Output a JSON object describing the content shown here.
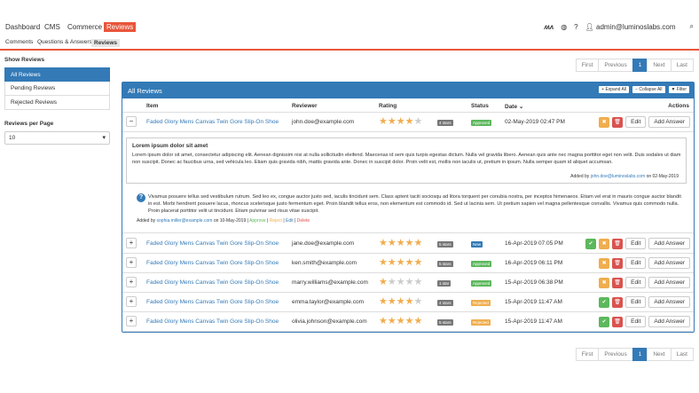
{
  "nav": {
    "items": [
      "Dashboard",
      "CMS",
      "Commerce",
      "Reviews"
    ],
    "user": "admin@luminoslabs.com",
    "help": "?",
    "sub": [
      "Comments",
      "Questions & Answers",
      "Reviews"
    ]
  },
  "sidebar": {
    "show_title": "Show Reviews",
    "filters": [
      "All Reviews",
      "Pending Reviews",
      "Rejected Reviews"
    ],
    "rpp_title": "Reviews per Page",
    "rpp_value": "10"
  },
  "pager": {
    "first": "First",
    "previous": "Previous",
    "page": "1",
    "next": "Next",
    "last": "Last"
  },
  "panel": {
    "title": "All Reviews",
    "expand": "Expand All",
    "collapse": "Collapse All",
    "filter": "Filter"
  },
  "columns": {
    "item": "Item",
    "reviewer": "Reviewer",
    "rating": "Rating",
    "status": "Status",
    "date": "Date",
    "actions": "Actions"
  },
  "labels": {
    "edit": "Edit",
    "add_answer": "Add Answer",
    "added_by": "Added by",
    "on": "on",
    "approve": "Approve",
    "reject": "Reject",
    "delete": "Delete"
  },
  "rows": [
    {
      "toggle": "−",
      "item": "Faded Glory Mens Canvas Twin Gore Slip-On Shoe",
      "reviewer": "john.doe@example.com",
      "stars": 4,
      "stars_label": "4 stars",
      "status": "Approved",
      "status_color": "#5cb85c",
      "date": "02-May-2019 02:47 PM",
      "approve": false
    },
    {
      "toggle": "+",
      "item": "Faded Glory Mens Canvas Twin Gore Slip-On Shoe",
      "reviewer": "jane.doe@example.com",
      "stars": 5,
      "stars_label": "5 stars",
      "status": "New",
      "status_color": "#337ab7",
      "date": "16-Apr-2019 07:05 PM",
      "approve": true
    },
    {
      "toggle": "+",
      "item": "Faded Glory Mens Canvas Twin Gore Slip-On Shoe",
      "reviewer": "ken.smith@example.com",
      "stars": 5,
      "stars_label": "5 stars",
      "status": "Approved",
      "status_color": "#5cb85c",
      "date": "16-Apr-2019 06:11 PM",
      "approve": false
    },
    {
      "toggle": "+",
      "item": "Faded Glory Mens Canvas Twin Gore Slip-On Shoe",
      "reviewer": "marry.williams@example.com",
      "stars": 1,
      "stars_label": "1 star",
      "status": "Approved",
      "status_color": "#5cb85c",
      "date": "15-Apr-2019 06:38 PM",
      "approve": false
    },
    {
      "toggle": "+",
      "item": "Faded Glory Mens Canvas Twin Gore Slip-On Shoe",
      "reviewer": "emma.taylor@example.com",
      "stars": 4,
      "stars_label": "4 stars",
      "status": "Rejected",
      "status_color": "#f0ad4e",
      "date": "15-Apr-2019 11:47 AM",
      "approve": true
    },
    {
      "toggle": "+",
      "item": "Faded Glory Mens Canvas Twin Gore Slip-On Shoe",
      "reviewer": "olivia.johnson@example.com",
      "stars": 5,
      "stars_label": "5 stars",
      "status": "Rejected",
      "status_color": "#f0ad4e",
      "date": "15-Apr-2019 11:47 AM",
      "approve": true
    }
  ],
  "detail": {
    "title": "Lorem ipsum dolor sit amet",
    "text": "Lorem ipsum dolor sit amet, consectetur adipiscing elit. Aenean dignissim nisi at nulla sollicitudin eleifend. Maecenas id sem quis turpis egestas dictum. Nulla vel gravida libero. Aenean quis ante nec magna porttitor eget non velit. Duis sodales ut diam non suscipit. Donec ac faucibus urna, sed vehicula leo. Etiam quis gravida nibh, mattis gravida ante. Donec in suscipit dolor. Proin velit est, mollis non iaculis ut, pretium in ipsum. Nulla semper quam id aliquet accumsan.",
    "by": "john.doe@luminoslabs.com",
    "by_date": "02-May-2019",
    "question": "Vivamus posuere tellus sed vestibulum rutrum. Sed leo ex, congue auctor justo sed, iaculis tincidunt sem. Class aptent taciti sociosqu ad litora torquent per conubia nostra, per inceptos himenaeos. Etiam vel erat in mauris congue auctor blandit in est. Morbi hendrerit posuere lacus, rhoncus scelerisque justo fermentum eget. Proin blandit tellus eros, non elementum est commodo id. Sed ut lacinia sem. Ut pretium sapien vel magna pellentesque convallis. Vivamus quis commodo nulla. Proin placerat porttitor velit ut tincidunt. Etiam pulvinar sed risus vitae suscipit.",
    "q_by": "sophia.miller@example.com",
    "q_date": "10-May-2019"
  }
}
